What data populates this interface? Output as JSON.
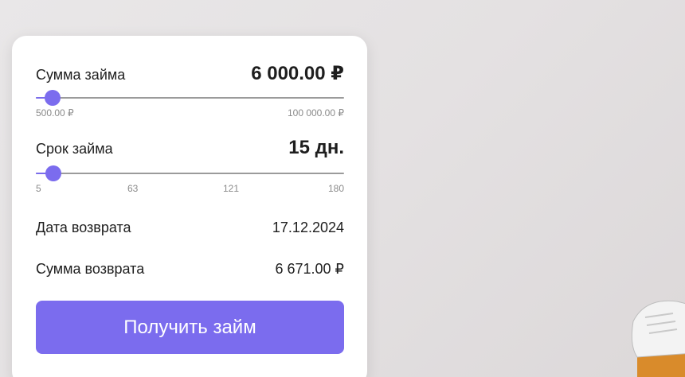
{
  "calculator": {
    "amount": {
      "label": "Сумма займа",
      "value_text": "6 000.00 ₽",
      "min_label": "500.00 ₽",
      "max_label": "100 000.00 ₽",
      "slider_fraction": 0.055
    },
    "term": {
      "label": "Срок займа",
      "value_text": "15 дн.",
      "ticks": [
        "5",
        "63",
        "121",
        "180"
      ],
      "slider_fraction": 0.057
    },
    "return_date": {
      "label": "Дата возврата",
      "value": "17.12.2024"
    },
    "return_sum": {
      "label": "Сумма возврата",
      "value": "6 671.00 ₽"
    },
    "submit_label": "Получить займ"
  },
  "colors": {
    "accent": "#7b6cee",
    "track": "#9b9b9b",
    "text": "#1e1e1e",
    "muted": "#8a8a8a"
  }
}
